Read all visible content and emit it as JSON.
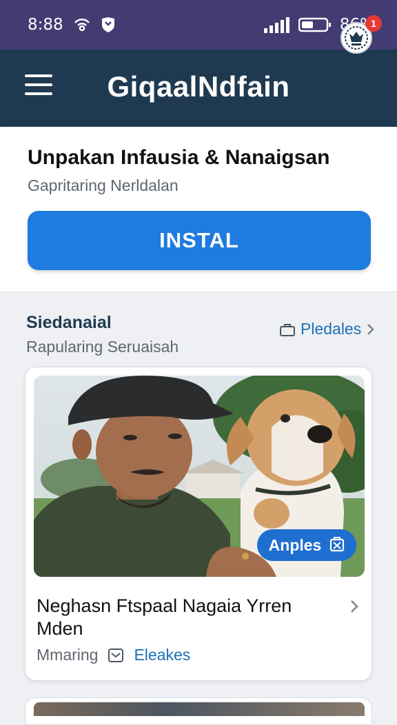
{
  "status_bar": {
    "time": "8:88",
    "battery_percent": "86%",
    "icons": [
      "wifi-hotspot-icon",
      "shield-icon",
      "signal-icon",
      "battery-icon"
    ]
  },
  "app_bar": {
    "title": "GiqaalNdfain",
    "notification_count": "1",
    "icons": [
      "menu-icon",
      "avatar-icon"
    ]
  },
  "top_card": {
    "title": "Unpakan Infausia & Nanaigsan",
    "subtitle": "Gapritaring Nerldalan",
    "install_label": "INSTAL"
  },
  "section": {
    "title": "Siedanaial",
    "subtitle": "Rapularing Seruaisah",
    "link_label": "Pledales"
  },
  "card": {
    "image_pill_label": "Anples",
    "title": "Neghasn Ftspaal Nagaia Yrren Mden",
    "meta_text": "Mmaring",
    "meta_link": "Eleakes"
  },
  "colors": {
    "status_bar": "#433c72",
    "app_bar": "#1f3a50",
    "accent": "#1e7be0",
    "link": "#1e6fb8",
    "badge": "#e53935"
  }
}
